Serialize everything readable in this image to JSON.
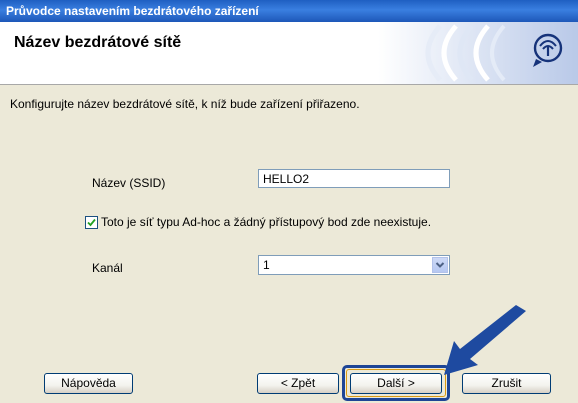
{
  "window": {
    "title": "Průvodce nastavením bezdrátového zařízení"
  },
  "header": {
    "title": "Název bezdrátové sítě",
    "logo_icon": "wireless-signal-icon"
  },
  "main": {
    "description": "Konfigurujte název bezdrátové sítě, k níž bude zařízení přiřazeno.",
    "ssid": {
      "label": "Název (SSID)",
      "value": "HELLO2"
    },
    "adhoc": {
      "checked": true,
      "label": "Toto je síť typu Ad-hoc a žádný přístupový bod zde neexistuje."
    },
    "channel": {
      "label": "Kanál",
      "selected": "1"
    }
  },
  "buttons": {
    "help": "Nápověda",
    "back": "< Zpět",
    "next": "Další >",
    "cancel": "Zrušit"
  },
  "colors": {
    "titlebar": "#2a6bd1",
    "dialog_bg": "#ece9d8",
    "highlight": "#1d4596",
    "arrow": "#1e4aa0"
  }
}
